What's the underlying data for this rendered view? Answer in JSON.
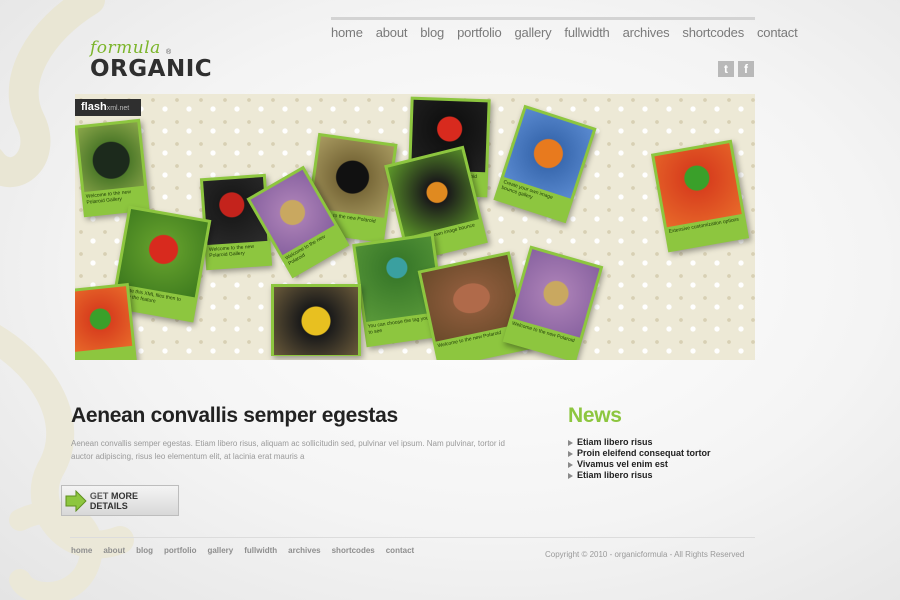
{
  "logo": {
    "script_text": "formula",
    "wordmark": "ORGANIC",
    "mark": "®"
  },
  "nav": [
    "home",
    "about",
    "blog",
    "portfolio",
    "gallery",
    "fullwidth",
    "archives",
    "shortcodes",
    "contact"
  ],
  "social": [
    {
      "icon": "twitter-icon",
      "glyph": "t"
    },
    {
      "icon": "facebook-icon",
      "glyph": "f"
    }
  ],
  "banner": {
    "badge": "flash",
    "badge_small": "xml.net",
    "card_captions": [
      "Welcome to the new Polaroid Gallery",
      "Update this XML files then to create the feature",
      "Welcome to the new Polaroid Gallery",
      "Create your own image bounce gallery",
      "Welcome to the new Polaroid",
      "Extensive customization options",
      "You can choose the tag you want to see",
      "Welcome to the new Polaroid",
      "Welcome to the new Polaroid"
    ]
  },
  "main": {
    "headline": "Aenean convallis semper egestas",
    "intro": "Aenean convallis semper egestas. Etiam libero risus, aliquam ac sollicitudin sed, pulvinar vel ipsum. Nam pulvinar, tortor id auctor adipiscing, risus leo elementum elit, at lacinia erat mauris a",
    "button_light": "GET",
    "button_bold": "MORE DETAILS"
  },
  "news": {
    "title": "News",
    "items": [
      "Etiam libero risus",
      "Proin eleifend consequat tortor",
      "Vivamus vel enim est",
      "Etiam libero risus"
    ]
  },
  "footer": {
    "nav": [
      "home",
      "about",
      "blog",
      "portfolio",
      "gallery",
      "fullwidth",
      "archives",
      "shortcodes",
      "contact"
    ],
    "copyright": "Copyright © 2010 -  organicformula - All Rights Reserved"
  },
  "colors": {
    "accent_green": "#8dc63f",
    "dark_text": "#222222",
    "muted_text": "#9a9a9a",
    "banner_bg": "#ede9d6"
  }
}
